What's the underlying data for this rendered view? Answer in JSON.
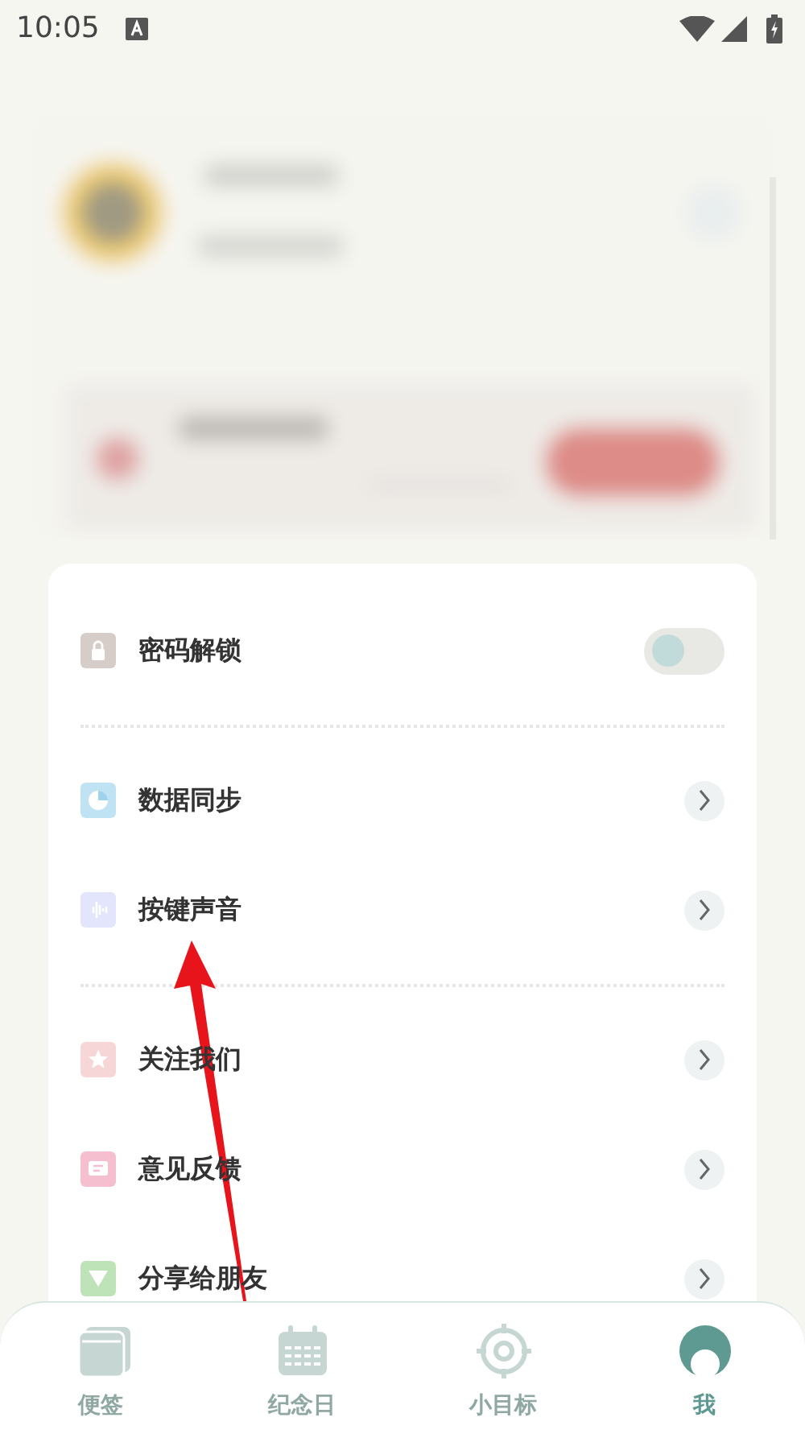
{
  "status_bar": {
    "time": "10:05"
  },
  "sections": [
    {
      "items": [
        {
          "kind": "toggle",
          "label": "密码解锁",
          "color": "#d6ccc8",
          "on": false
        }
      ]
    },
    {
      "items": [
        {
          "kind": "link",
          "label": "数据同步",
          "color": "#bfe3f3"
        },
        {
          "kind": "link",
          "label": "按键声音",
          "color": "#e2e5fb"
        }
      ]
    },
    {
      "items": [
        {
          "kind": "link",
          "label": "关注我们",
          "color": "#f7d6d8"
        },
        {
          "kind": "link",
          "label": "意见反馈",
          "color": "#f6bfcf"
        },
        {
          "kind": "link",
          "label": "分享给朋友",
          "color": "#bfe3b8"
        }
      ]
    }
  ],
  "tabs": [
    {
      "label": "便签",
      "selected": false
    },
    {
      "label": "纪念日",
      "selected": false
    },
    {
      "label": "小目标",
      "selected": false
    },
    {
      "label": "我",
      "selected": true
    }
  ],
  "annotation": {
    "kind": "arrow"
  }
}
